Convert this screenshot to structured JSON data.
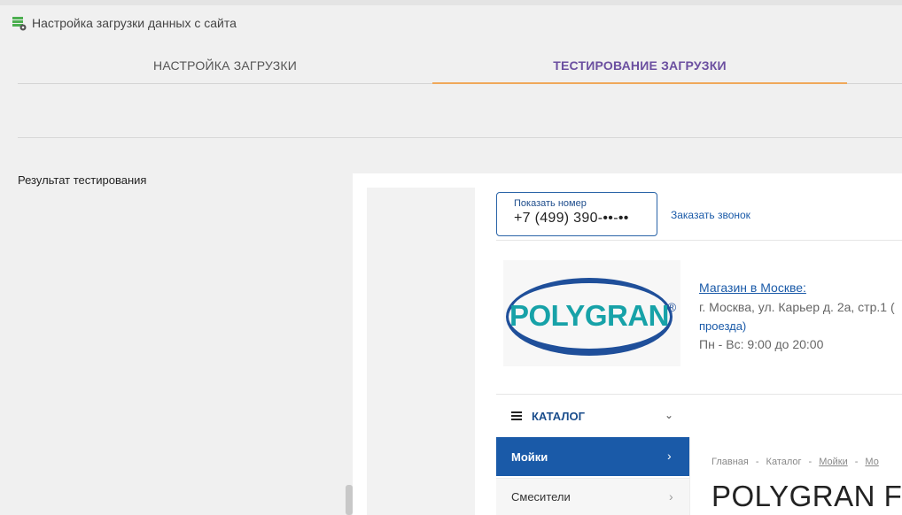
{
  "header": {
    "title": "Настройка загрузки данных с сайта",
    "icon": "database-settings-icon"
  },
  "tabs": [
    {
      "label": "НАСТРОЙКА ЗАГРУЗКИ",
      "active": false
    },
    {
      "label": "ТЕСТИРОВАНИЕ ЗАГРУЗКИ",
      "active": true
    }
  ],
  "colors": {
    "active_tab_text": "#6b4fa0",
    "active_tab_underline": "#f0a85a",
    "site_blue": "#1a5aa8"
  },
  "result": {
    "label": "Результат тестирования"
  },
  "preview": {
    "phone": {
      "show_label": "Показать номер",
      "number": "+7 (499) 390-••-••"
    },
    "callback": "Заказать звонок",
    "logo": {
      "text": "POLYGRAN",
      "mark": "®"
    },
    "store": {
      "link": "Магазин в Москве:",
      "address": "г. Москва, ул. Карьер д. 2а, стр.1 (",
      "passage": "проезда)",
      "hours": "Пн - Вс: 9:00 до 20:00"
    },
    "catalog": {
      "label": "КАТАЛОГ"
    },
    "menu": [
      {
        "label": "Мойки",
        "active": true
      },
      {
        "label": "Смесители",
        "active": false
      }
    ],
    "breadcrumbs": [
      "Главная",
      "Каталог",
      "Мойки",
      "Мо"
    ],
    "page_title": "POLYGRAN F"
  }
}
